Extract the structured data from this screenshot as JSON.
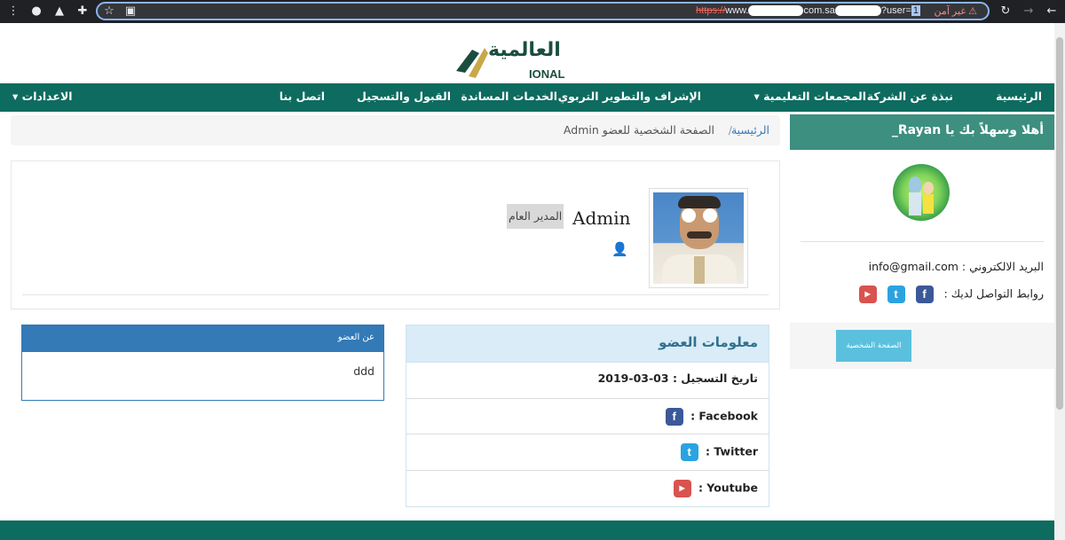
{
  "browser": {
    "url_scheme": "https://",
    "url_host_start": "www.",
    "url_host_mid": "com.sa",
    "url_query": "?user=",
    "url_selected": "1",
    "security_label": "غير آمن",
    "icons": [
      "back-icon",
      "forward-icon",
      "reload-icon",
      "bookmark-star-icon",
      "extensions-icon",
      "profile-icon",
      "menu-icon"
    ]
  },
  "logo": {
    "arabic": "العالمية",
    "english": "IONAL"
  },
  "nav": {
    "items": [
      "الرئيسية",
      "نبذة عن الشركة",
      "المجمعات التعليمية",
      "الإشراف والتطوير التربوي",
      "الخدمات المساندة",
      "القبول والتسجيل",
      "اتصل بنا"
    ],
    "settings": "الاعدادات",
    "caret": "▾"
  },
  "breadcrumb": {
    "home": "الرئيسية",
    "separator": "/",
    "current": "الصفحة الشخصية للعضو Admin"
  },
  "profile": {
    "name": "Admin",
    "role": "المدير العام"
  },
  "member_info": {
    "title": "معلومات العضو",
    "registration_label": "تاريخ التسجيل :",
    "registration_date": "03-03-2019",
    "facebook_label": "Facebook :",
    "twitter_label": "Twitter :",
    "youtube_label": "Youtube :"
  },
  "about": {
    "title": "عن العضو",
    "body": "ddd"
  },
  "sidebar": {
    "welcome": "أهلا وسهلاً بك يا Rayan_",
    "email_label": "البريد الالكتروني :",
    "email": "info@gmail.com",
    "social_label": "روابط التواصل لديك :",
    "profile_button": "الصفحة الشخصية"
  },
  "colors": {
    "nav_green": "#0e6b5f",
    "sidebar_header": "#3d8f80",
    "about_blue": "#337ab7",
    "info_head": "#d9ecf7",
    "button_cyan": "#5bc0de"
  }
}
